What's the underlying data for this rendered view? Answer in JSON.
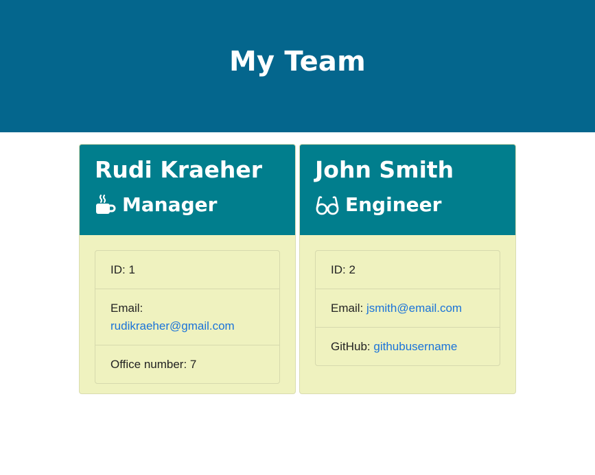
{
  "header": {
    "title": "My Team"
  },
  "cards": [
    {
      "name": "Rudi Kraeher",
      "role": "Manager",
      "role_icon": "coffee-mug-icon",
      "id_text": "ID: 1",
      "email_label": "Email:",
      "email": "rudikraeher@gmail.com",
      "extra_text": "Office number: 7"
    },
    {
      "name": "John Smith",
      "role": "Engineer",
      "role_icon": "glasses-icon",
      "id_text": "ID: 2",
      "email_label": "Email:",
      "email": "jsmith@email.com",
      "extra_label": "GitHub:",
      "github": "githubusername"
    }
  ],
  "colors": {
    "header_bg": "#04668d",
    "card_head_bg": "#017e8d",
    "card_body_bg": "#eff2bf",
    "link": "#1a73d9"
  }
}
